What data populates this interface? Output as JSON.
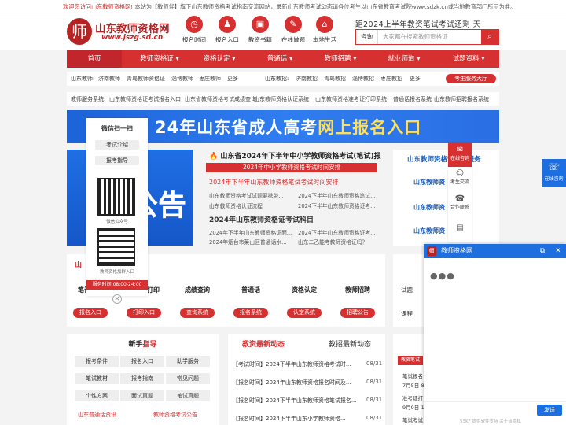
{
  "topbar": {
    "notice_red": "欢迎您访问山东教师资格网!",
    "notice": "本站为【教师伴】旗下山东教师资格考试指南交流网站，最新山东教师考试动态请各位考生以山东省教育考试院www.sdzk.cn或当地教育部门所示为准。"
  },
  "logo": {
    "seal": "师",
    "title": "山东教师资格网",
    "url": "www.jszg.sd.cn"
  },
  "quicklinks": [
    {
      "label": "报名时间",
      "icon": "clock-icon",
      "glyph": "◷"
    },
    {
      "label": "报名入口",
      "icon": "person-icon",
      "glyph": "♟"
    },
    {
      "label": "教资书籍",
      "icon": "book-icon",
      "glyph": "▣"
    },
    {
      "label": "在线做题",
      "icon": "edit-icon",
      "glyph": "✎"
    },
    {
      "label": "本地生活",
      "icon": "home-icon",
      "glyph": "⌂"
    }
  ],
  "slogan": "距2024上半年教资笔试考试还剩 天",
  "search": {
    "label": "咨询",
    "placeholder": "大家都在搜索教师资格证",
    "btn": "⌕"
  },
  "nav": [
    {
      "label": "首页"
    },
    {
      "label": "教师资格证 ▾"
    },
    {
      "label": "资格认定 ▾"
    },
    {
      "label": "普通话 ▾"
    },
    {
      "label": "教师招聘 ▾"
    },
    {
      "label": "就业师道 ▾"
    },
    {
      "label": "试题资料 ▾"
    }
  ],
  "row1": {
    "k1": "山东教师:",
    "l1": [
      "济南教师",
      "青岛教师资格证",
      "淄博教师",
      "枣庄教师",
      "更多"
    ],
    "k2": "山东教招:",
    "l2": [
      "济南教招",
      "青岛教招",
      "淄博教招",
      "枣庄教招",
      "更多"
    ],
    "pill": "考生服务大厅"
  },
  "row2": {
    "k": "教师服务系统:",
    "l": [
      "山东教师资格证考试报名入口",
      "山东省教师资格考试成绩查询",
      "山东教师资格认证系统",
      "山东教师资格准考证打印系统",
      "普通话报名系统",
      "山东教师招聘报名系统"
    ]
  },
  "banner": {
    "pre": "2",
    "text": "4年山东省成人高考",
    "hl": "网上报名入口"
  },
  "blueimg": {
    "big": "公告",
    "big2": "鲁"
  },
  "news": {
    "headline": "🔥 山东省2024年下半年中小学教师资格考试(笔试)报",
    "bar": "2024年中小学教师资格考试时间安排",
    "sub": "2024年下半年山东教师资格笔试考试时间安排",
    "items1": [
      "山东教师资格考试试题要携带...",
      "2024下半年山东教师资格笔试...",
      "山东教师资格认证流程",
      "2024下半年山东教师资格证考..."
    ],
    "sec": "2024年山东教师资格证考试科目",
    "items2": [
      "2024年下半年山东教师资格证面...",
      "2024下半年山东教师资格证考...",
      "2024年烟台市莱山区普通话水...",
      "山东二乙能考教师资格证吗？"
    ]
  },
  "rcard": {
    "title": "山东教师资格证考试服务",
    "items": [
      "山东教师资",
      "山东教师资",
      "山东教师资"
    ]
  },
  "wechat": {
    "title": "微信扫一扫",
    "btn1": "考试介绍",
    "btn2": "报考指导",
    "cap1": "微信公众号",
    "cap2": "教师资格加群入口",
    "time": "服务时间 08:00-24:00",
    "close": "✕"
  },
  "steps": {
    "tab": "山",
    "items": [
      {
        "title": "笔试报名",
        "btn": "报名入口"
      },
      {
        "title": "准考证打印",
        "btn": "打印入口"
      },
      {
        "title": "成绩查询",
        "btn": "查询系统"
      },
      {
        "title": "普通话",
        "btn": "报名系统"
      },
      {
        "title": "资格认定",
        "btn": "认定系统"
      },
      {
        "title": "教师招聘",
        "btn": "招聘公告"
      }
    ]
  },
  "side2": {
    "items": [
      "试题",
      "课程"
    ]
  },
  "guide": {
    "title_pre": "新手",
    "title_hl": "指导",
    "buttons": [
      "报考条件",
      "报名入口",
      "助学服务",
      "笔试教材",
      "报考指南",
      "常见问题",
      "个性方案",
      "面试真题",
      "笔试真题"
    ],
    "links": [
      "山东普通话资讯",
      "教师资格考试公告"
    ]
  },
  "dyn": {
    "tab1_pre": "教资",
    "tab1_hl": "最新动态",
    "tab2": "教招最新动态",
    "items": [
      {
        "t": "【考试时间】2024下半年山东教师资格考试时...",
        "d": "08/31"
      },
      {
        "t": "【报名时间】2024年山东教师资格报名时间及...",
        "d": "08/31"
      },
      {
        "t": "【报名时间】2024下半年山东教师资格笔试报名...",
        "d": "08/31"
      },
      {
        "t": "【报名时间】2024下半年山东小学教师资格...",
        "d": "08/31"
      }
    ]
  },
  "side3": {
    "tag": "教资笔试",
    "items": [
      "笔试报名",
      "7月5日-8",
      "准考证打",
      "9月9日-15",
      "笔试考试"
    ]
  },
  "float": [
    {
      "label": "在线咨询",
      "icon": "chat-icon",
      "glyph": "✉"
    },
    {
      "label": "考生交流",
      "icon": "group-icon",
      "glyph": "☺"
    },
    {
      "label": "合作联系",
      "icon": "phone-icon",
      "glyph": "☎"
    },
    {
      "label": "",
      "icon": "briefcase-icon",
      "glyph": "▤"
    }
  ],
  "online": {
    "label": "在线咨询",
    "glyph": "☏"
  },
  "chat": {
    "avatar": "师",
    "title": "教师资格网",
    "dots": "●●●",
    "send": "发送",
    "powered": "53KF 提供软件支持  关于该隐私",
    "icons": [
      "⧉",
      "✕"
    ]
  }
}
